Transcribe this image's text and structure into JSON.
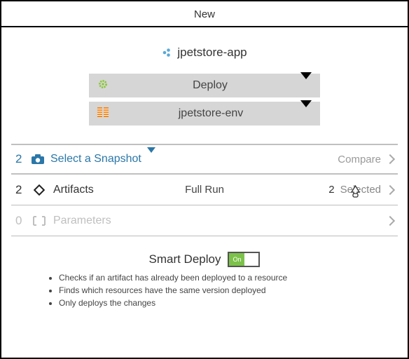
{
  "header": {
    "title": "New"
  },
  "app": {
    "name": "jpetstore-app"
  },
  "selects": {
    "action": "Deploy",
    "environment": "jpetstore-env"
  },
  "rows": {
    "snapshot": {
      "count": "2",
      "label": "Select a Snapshot",
      "compare": "Compare"
    },
    "artifacts": {
      "count": "2",
      "label": "Artifacts",
      "mode": "Full Run",
      "selected_count": "2",
      "selected_label": "Selected"
    },
    "parameters": {
      "count": "0",
      "label": "Parameters"
    }
  },
  "smart_deploy": {
    "title": "Smart Deploy",
    "toggle_on": "On",
    "bullets": [
      "Checks if an artifact has already been deployed to a resource",
      "Finds which resources have the same version deployed",
      "Only deploys the changes"
    ]
  }
}
